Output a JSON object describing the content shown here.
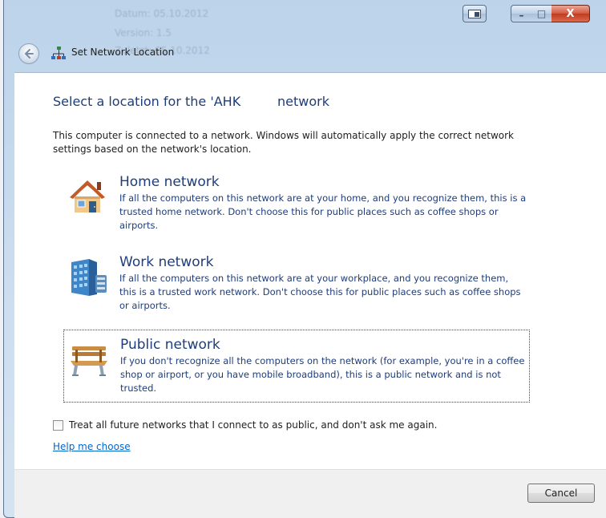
{
  "window": {
    "title": "Set Network Location",
    "background_ghost": [
      "Datum: 05.10.2012",
      "Version: 1.5",
      "Zuletzt: 05.10.2012"
    ]
  },
  "caption": {
    "minimize_glyph": "–",
    "maximize_glyph": "□",
    "close_glyph": "X"
  },
  "main": {
    "heading": "Select a location for the 'AHK         network",
    "intro": "This computer is connected to a network. Windows will automatically apply the correct network settings based on the network's location.",
    "options": [
      {
        "title": "Home network",
        "description": "If all the computers on this network are at your home, and you recognize them, this is a trusted home network.  Don't choose this for public places such as coffee shops or airports.",
        "icon": "house-icon"
      },
      {
        "title": "Work network",
        "description": "If all the computers on this network are at your workplace, and you recognize them, this is a trusted work network.  Don't choose this for public places such as coffee shops or airports.",
        "icon": "office-building-icon"
      },
      {
        "title": "Public network",
        "description": "If you don't recognize all the computers on the network (for example, you're in a coffee shop or airport, or you have mobile broadband), this is a public network and is not trusted.",
        "icon": "park-bench-icon"
      }
    ],
    "checkbox_label": "Treat all future networks that I connect to as public, and don't ask me again.",
    "help_link": "Help me choose"
  },
  "footer": {
    "cancel_label": "Cancel"
  },
  "colors": {
    "heading": "#1e3d7b",
    "link": "#0066cc",
    "close_button": "#c23a1e"
  }
}
